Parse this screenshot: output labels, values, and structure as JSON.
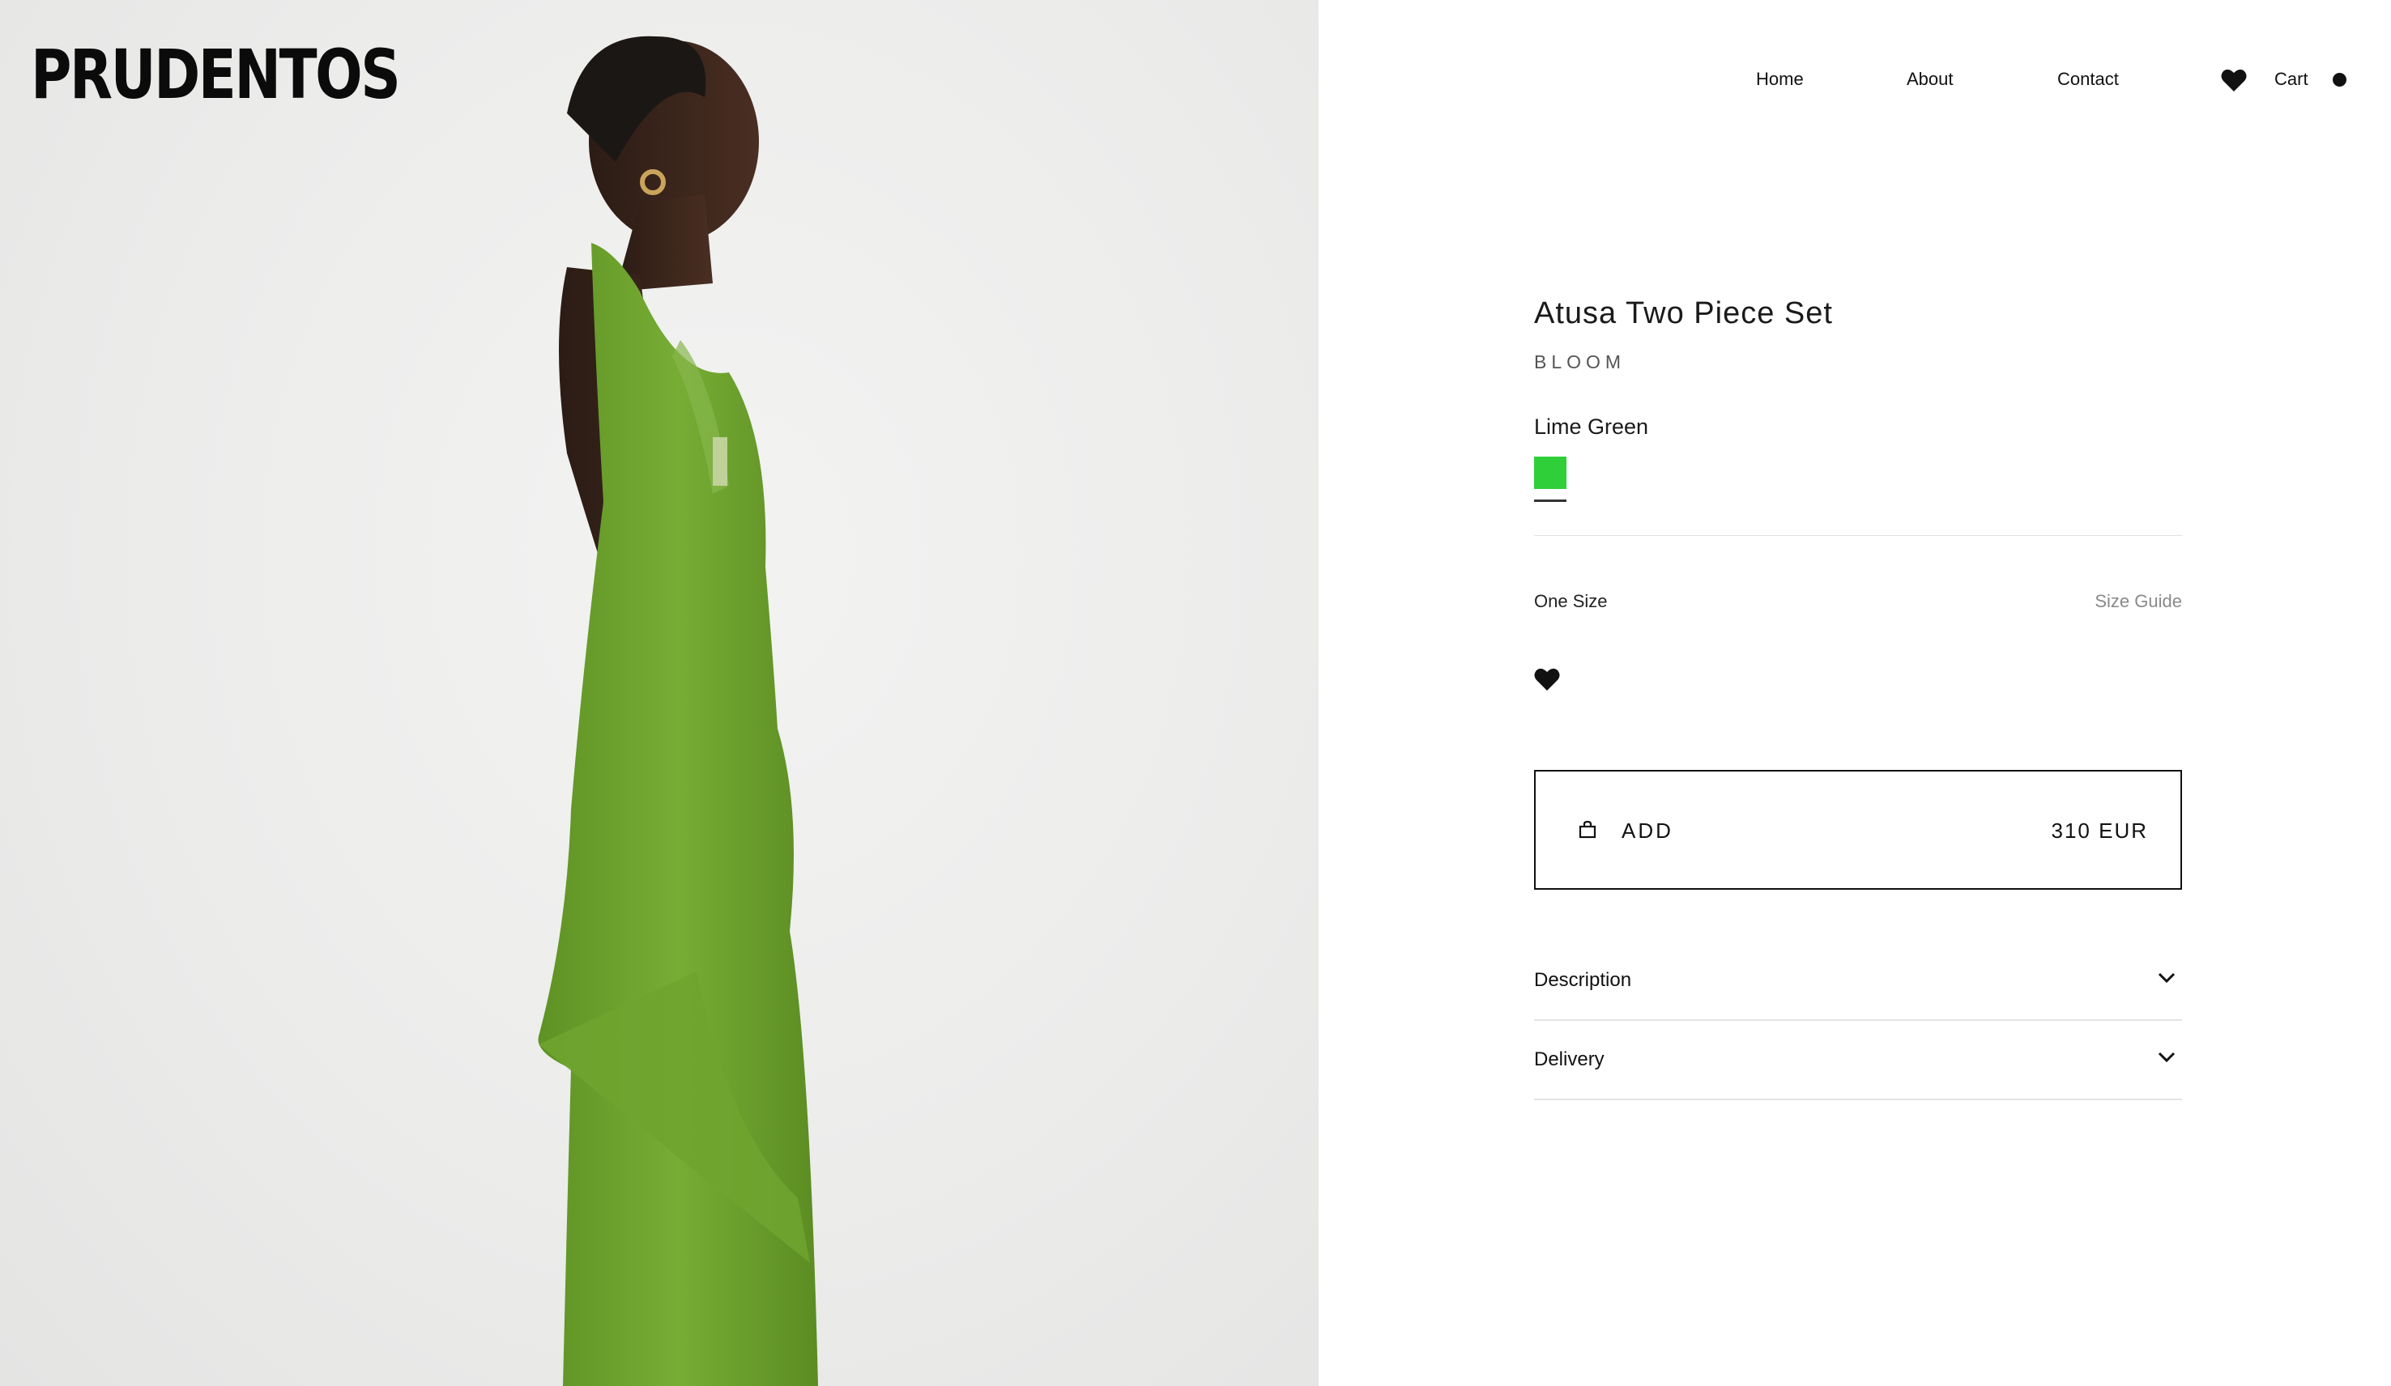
{
  "brand": {
    "logo_text": "PRUDENTOS"
  },
  "nav": {
    "home": "Home",
    "about": "About",
    "contact": "Contact",
    "wishlist_icon": "heart-icon",
    "cart": "Cart",
    "cart_indicator_icon": "dot-icon"
  },
  "product": {
    "title": "Atusa Two Piece Set",
    "collection": "BLOOM",
    "color_name": "Lime Green",
    "swatch_color": "#2fcf3a",
    "size": "One Size",
    "size_guide": "Size Guide",
    "wishlist_icon": "heart-icon",
    "add_button": {
      "icon": "shopping-bag-icon",
      "label": "ADD",
      "price": "310 EUR"
    },
    "accordions": [
      {
        "label": "Description",
        "icon": "chevron-down-icon"
      },
      {
        "label": "Delivery",
        "icon": "chevron-down-icon"
      }
    ]
  },
  "colors": {
    "text": "#111111",
    "muted": "#8a8a8a",
    "hero_background": "#ececeb",
    "dress_green": "#6aa02c"
  }
}
